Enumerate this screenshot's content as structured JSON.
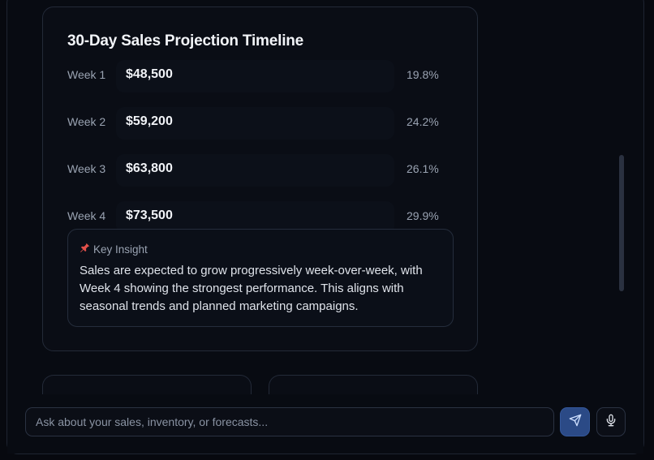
{
  "projection": {
    "title": "30-Day Sales Projection Timeline",
    "weeks": [
      {
        "label": "Week 1",
        "value": "$48,500",
        "pct": "19.8%"
      },
      {
        "label": "Week 2",
        "value": "$59,200",
        "pct": "24.2%"
      },
      {
        "label": "Week 3",
        "value": "$63,800",
        "pct": "26.1%"
      },
      {
        "label": "Week 4",
        "value": "$73,500",
        "pct": "29.9%"
      }
    ],
    "insight": {
      "icon": "pushpin-icon",
      "heading": "Key Insight",
      "body": "Sales are expected to grow progressively week-over-week, with Week 4 showing the strongest performance. This aligns with seasonal trends and planned marketing campaigns."
    }
  },
  "composer": {
    "placeholder": "Ask about your sales, inventory, or forecasts...",
    "value": "",
    "send_icon": "send-icon",
    "mic_icon": "microphone-icon"
  },
  "colors": {
    "background": "#07090f",
    "card": "#0a0d15",
    "accent": "#2b4a86",
    "muted_text": "#9aa3b2"
  }
}
